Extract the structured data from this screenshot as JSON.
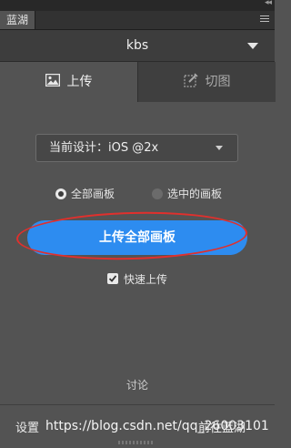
{
  "panel": {
    "tab_label": "蓝湖",
    "menu_icon": "hamburger-icon",
    "collapse_icon": "double-arrow-icon"
  },
  "project": {
    "name": "kbs"
  },
  "modes": {
    "upload_label": "上传",
    "slice_label": "切图"
  },
  "design_select": {
    "value": "当前设计：iOS @2x"
  },
  "options": {
    "all_artboards": "全部画板",
    "selected_artboards": "选中的画板",
    "selected": "all_artboards"
  },
  "upload_button": {
    "label": "上传全部画板"
  },
  "quick_upload": {
    "label": "快速上传",
    "checked": true
  },
  "discuss": {
    "label": "讨论"
  },
  "footer": {
    "settings": "设置",
    "goto": "前往蓝湖"
  },
  "watermark": "https://blog.csdn.net/qq_26003101",
  "colors": {
    "background": "#535353",
    "accent": "#2d8cf0",
    "highlight": "#e0302d"
  }
}
